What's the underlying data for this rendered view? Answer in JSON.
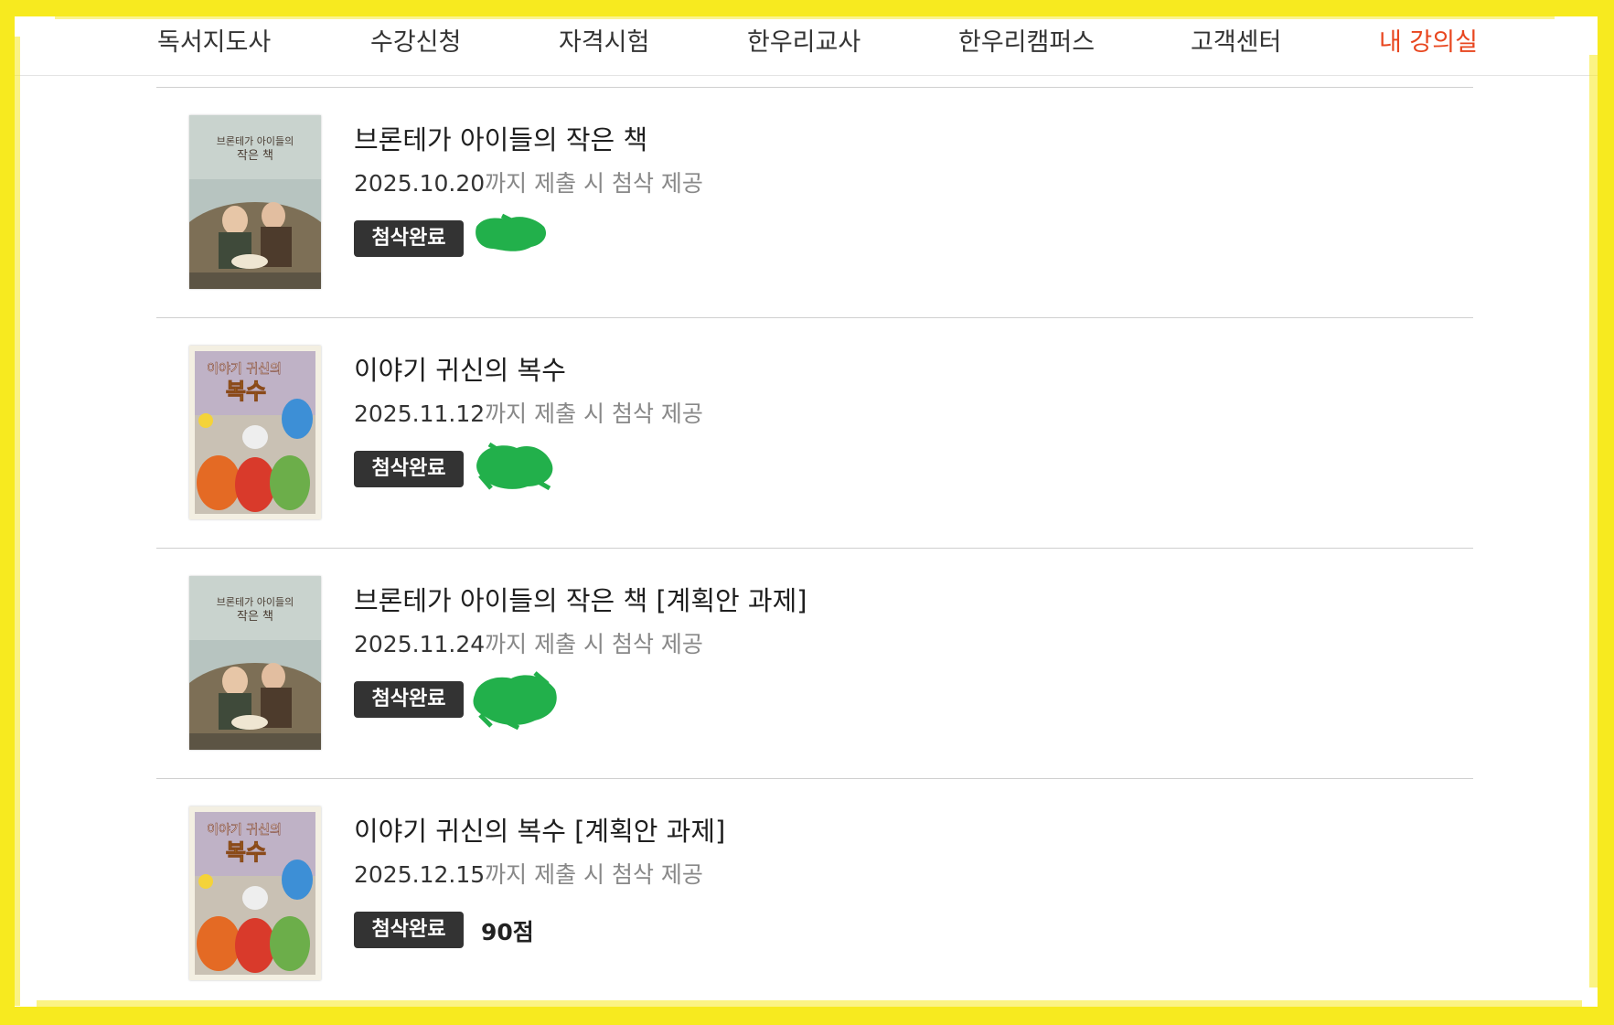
{
  "nav": {
    "items": [
      {
        "label": "독서지도사"
      },
      {
        "label": "수강신청"
      },
      {
        "label": "자격시험"
      },
      {
        "label": "한우리교사"
      },
      {
        "label": "한우리캠퍼스"
      },
      {
        "label": "고객센터"
      },
      {
        "label": "내 강의실"
      }
    ],
    "active_color": "#e8461f"
  },
  "assignments": [
    {
      "title": "브론테가 아이들의 작은 책",
      "due_date": "2025.10.20",
      "due_suffix": "까지 제출 시 첨삭 제공",
      "status": "첨삭완료",
      "score": null,
      "score_redacted": true,
      "cover": {
        "title_line1": "브론테가 아이들의",
        "title_line2": "작은 책"
      }
    },
    {
      "title": "이야기 귀신의 복수",
      "due_date": "2025.11.12",
      "due_suffix": "까지 제출 시 첨삭 제공",
      "status": "첨삭완료",
      "score": null,
      "score_redacted": true,
      "cover": {
        "title_line1": "이야기 귀신의",
        "title_line2": "복수"
      }
    },
    {
      "title": "브론테가 아이들의 작은 책 [계획안 과제]",
      "due_date": "2025.11.24",
      "due_suffix": "까지 제출 시 첨삭 제공",
      "status": "첨삭완료",
      "score": null,
      "score_redacted": true,
      "cover": {
        "title_line1": "브론테가 아이들의",
        "title_line2": "작은 책"
      }
    },
    {
      "title": "이야기 귀신의 복수 [계획안 과제]",
      "due_date": "2025.12.15",
      "due_suffix": "까지 제출 시 첨삭 제공",
      "status": "첨삭완료",
      "score": "90점",
      "score_redacted": false,
      "cover": {
        "title_line1": "이야기 귀신의",
        "title_line2": "복수"
      }
    }
  ],
  "colors": {
    "highlight_frame": "#f7ea1f",
    "redaction": "#22b04b",
    "badge_bg": "#333333"
  }
}
